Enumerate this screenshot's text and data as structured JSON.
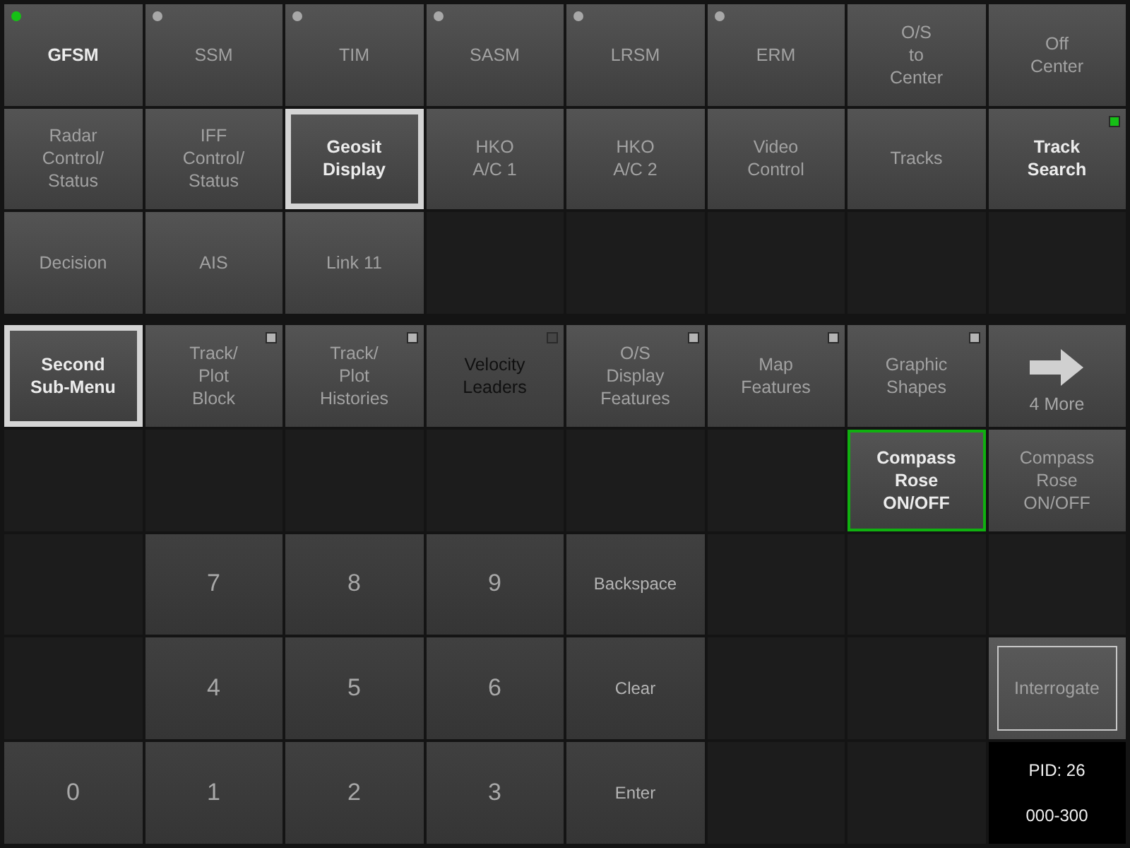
{
  "top_grid": [
    {
      "kind": "menu",
      "label": "GFSM",
      "active": true,
      "dimmed": false,
      "selected": false,
      "highlighted": false,
      "outlined": false,
      "led": {
        "kind": "dot",
        "color": "#16c016"
      }
    },
    {
      "kind": "menu",
      "label": "SSM",
      "active": false,
      "dimmed": false,
      "selected": false,
      "highlighted": false,
      "outlined": false,
      "led": {
        "kind": "dot",
        "color": "#a8a8a8"
      }
    },
    {
      "kind": "menu",
      "label": "TIM",
      "active": false,
      "dimmed": false,
      "selected": false,
      "highlighted": false,
      "outlined": false,
      "led": {
        "kind": "dot",
        "color": "#a8a8a8"
      }
    },
    {
      "kind": "menu",
      "label": "SASM",
      "active": false,
      "dimmed": false,
      "selected": false,
      "highlighted": false,
      "outlined": false,
      "led": {
        "kind": "dot",
        "color": "#a8a8a8"
      }
    },
    {
      "kind": "menu",
      "label": "LRSM",
      "active": false,
      "dimmed": false,
      "selected": false,
      "highlighted": false,
      "outlined": false,
      "led": {
        "kind": "dot",
        "color": "#a8a8a8"
      }
    },
    {
      "kind": "menu",
      "label": "ERM",
      "active": false,
      "dimmed": false,
      "selected": false,
      "highlighted": false,
      "outlined": false,
      "led": {
        "kind": "dot",
        "color": "#a8a8a8"
      }
    },
    {
      "kind": "menu",
      "label": "O/S\nto\nCenter",
      "active": false,
      "dimmed": false,
      "selected": false,
      "highlighted": false,
      "outlined": false
    },
    {
      "kind": "menu",
      "label": "Off\nCenter",
      "active": false,
      "dimmed": false,
      "selected": false,
      "highlighted": false,
      "outlined": false
    },
    {
      "kind": "menu",
      "label": "Radar\nControl/\nStatus",
      "active": false,
      "dimmed": false,
      "selected": false,
      "highlighted": false,
      "outlined": false
    },
    {
      "kind": "menu",
      "label": "IFF\nControl/\nStatus",
      "active": false,
      "dimmed": false,
      "selected": false,
      "highlighted": false,
      "outlined": false
    },
    {
      "kind": "menu",
      "label": "Geosit\nDisplay",
      "active": true,
      "dimmed": false,
      "selected": true,
      "highlighted": false,
      "outlined": false
    },
    {
      "kind": "menu",
      "label": "HKO\nA/C 1",
      "active": false,
      "dimmed": false,
      "selected": false,
      "highlighted": false,
      "outlined": false
    },
    {
      "kind": "menu",
      "label": "HKO\nA/C 2",
      "active": false,
      "dimmed": false,
      "selected": false,
      "highlighted": false,
      "outlined": false
    },
    {
      "kind": "menu",
      "label": "Video\nControl",
      "active": false,
      "dimmed": false,
      "selected": false,
      "highlighted": false,
      "outlined": false
    },
    {
      "kind": "menu",
      "label": "Tracks",
      "active": false,
      "dimmed": false,
      "selected": false,
      "highlighted": false,
      "outlined": false
    },
    {
      "kind": "menu",
      "label": "Track\nSearch",
      "active": true,
      "dimmed": false,
      "selected": false,
      "highlighted": false,
      "outlined": false,
      "led": {
        "kind": "square",
        "color": "#16c016"
      }
    },
    {
      "kind": "menu",
      "label": "Decision",
      "active": false,
      "dimmed": false,
      "selected": false,
      "highlighted": false,
      "outlined": false
    },
    {
      "kind": "menu",
      "label": "AIS",
      "active": false,
      "dimmed": false,
      "selected": false,
      "highlighted": false,
      "outlined": false
    },
    {
      "kind": "menu",
      "label": "Link 11",
      "active": false,
      "dimmed": false,
      "selected": false,
      "highlighted": false,
      "outlined": false
    },
    {
      "kind": "blank"
    },
    {
      "kind": "blank"
    },
    {
      "kind": "blank"
    },
    {
      "kind": "blank"
    },
    {
      "kind": "blank"
    }
  ],
  "bottom_grid": [
    {
      "kind": "menu",
      "label": "Second\nSub-Menu",
      "active": true,
      "dimmed": false,
      "selected": true,
      "highlighted": false,
      "outlined": false
    },
    {
      "kind": "menu",
      "label": "Track/\nPlot\nBlock",
      "active": false,
      "dimmed": false,
      "selected": false,
      "highlighted": false,
      "outlined": false,
      "led": {
        "kind": "square",
        "color": "#b4b4b4"
      }
    },
    {
      "kind": "menu",
      "label": "Track/\nPlot\nHistories",
      "active": false,
      "dimmed": false,
      "selected": false,
      "highlighted": false,
      "outlined": false,
      "led": {
        "kind": "square",
        "color": "#b4b4b4"
      }
    },
    {
      "kind": "menu",
      "label": "Velocity\nLeaders",
      "active": false,
      "dimmed": true,
      "selected": false,
      "highlighted": false,
      "outlined": false,
      "led": {
        "kind": "square",
        "color": "#454545"
      }
    },
    {
      "kind": "menu",
      "label": "O/S\nDisplay\nFeatures",
      "active": false,
      "dimmed": false,
      "selected": false,
      "highlighted": false,
      "outlined": false,
      "led": {
        "kind": "square",
        "color": "#b4b4b4"
      }
    },
    {
      "kind": "menu",
      "label": "Map\nFeatures",
      "active": false,
      "dimmed": false,
      "selected": false,
      "highlighted": false,
      "outlined": false,
      "led": {
        "kind": "square",
        "color": "#b4b4b4"
      }
    },
    {
      "kind": "menu",
      "label": "Graphic\nShapes",
      "active": false,
      "dimmed": false,
      "selected": false,
      "highlighted": false,
      "outlined": false,
      "led": {
        "kind": "square",
        "color": "#b4b4b4"
      }
    },
    {
      "kind": "arrow",
      "label": "4 More"
    },
    {
      "kind": "blank"
    },
    {
      "kind": "blank"
    },
    {
      "kind": "blank"
    },
    {
      "kind": "blank"
    },
    {
      "kind": "blank"
    },
    {
      "kind": "blank"
    },
    {
      "kind": "menu",
      "label": "Compass\nRose\nON/OFF",
      "active": true,
      "dimmed": false,
      "selected": false,
      "highlighted": true,
      "outlined": false
    },
    {
      "kind": "menu",
      "label": "Compass\nRose\nON/OFF",
      "active": false,
      "dimmed": false,
      "selected": false,
      "highlighted": false,
      "outlined": false
    },
    {
      "kind": "blank"
    },
    {
      "kind": "digit",
      "label": "7"
    },
    {
      "kind": "digit",
      "label": "8"
    },
    {
      "kind": "digit",
      "label": "9"
    },
    {
      "kind": "command",
      "label": "Backspace"
    },
    {
      "kind": "blank"
    },
    {
      "kind": "blank"
    },
    {
      "kind": "blank"
    },
    {
      "kind": "blank"
    },
    {
      "kind": "digit",
      "label": "4"
    },
    {
      "kind": "digit",
      "label": "5"
    },
    {
      "kind": "digit",
      "label": "6"
    },
    {
      "kind": "command",
      "label": "Clear"
    },
    {
      "kind": "blank"
    },
    {
      "kind": "blank"
    },
    {
      "kind": "menu",
      "label": "Interrogate",
      "active": false,
      "dimmed": false,
      "selected": false,
      "highlighted": false,
      "outlined": true
    },
    {
      "kind": "digit",
      "label": "0"
    },
    {
      "kind": "digit",
      "label": "1"
    },
    {
      "kind": "digit",
      "label": "2"
    },
    {
      "kind": "digit",
      "label": "3"
    },
    {
      "kind": "command",
      "label": "Enter"
    },
    {
      "kind": "blank"
    },
    {
      "kind": "blank"
    },
    {
      "kind": "readout",
      "lines": [
        "PID: 26",
        "000-300"
      ]
    }
  ]
}
